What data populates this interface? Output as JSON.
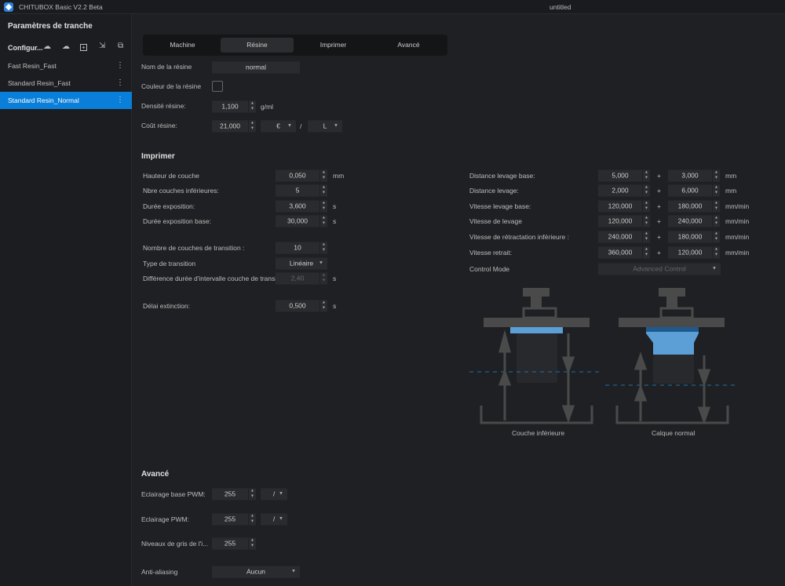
{
  "app": {
    "title": "CHITUBOX Basic V2.2 Beta",
    "document": "untitled"
  },
  "sidebar": {
    "title": "Paramètres de tranche",
    "config_label": "Configur...",
    "items": [
      {
        "label": "Fast Resin_Fast"
      },
      {
        "label": "Standard Resin_Fast"
      },
      {
        "label": "Standard Resin_Normal",
        "selected": true
      }
    ]
  },
  "tabs": [
    "Machine",
    "Résine",
    "Imprimer",
    "Avancé"
  ],
  "active_tab": "Résine",
  "resin": {
    "name_label": "Nom de la résine",
    "name_value": "normal",
    "color_label": "Couleur de la résine",
    "density_label": "Densité résine:",
    "density_value": "1,100",
    "density_unit": "g/ml",
    "cost_label": "Coût résine:",
    "cost_value": "21,000",
    "currency": "€",
    "slash": "/",
    "volume_unit": "L"
  },
  "print": {
    "title": "Imprimer",
    "left": [
      {
        "label": "Hauteur de couche",
        "value": "0,050",
        "unit": "mm"
      },
      {
        "label": "Nbre couches inférieures:",
        "value": "5",
        "unit": ""
      },
      {
        "label": "Durée exposition:",
        "value": "3,600",
        "unit": "s"
      },
      {
        "label": "Durée exposition base:",
        "value": "30,000",
        "unit": "s"
      },
      {
        "label": "Nombre de couches de transition :",
        "value": "10",
        "unit": ""
      },
      {
        "label": "Type de transition",
        "value": "Linéaire",
        "unit": "",
        "type": "select"
      },
      {
        "label": "Différence durée d'intervalle couche de transit...",
        "value": "2,40",
        "unit": "s",
        "disabled": true
      },
      {
        "label": "Délai extinction:",
        "value": "0,500",
        "unit": "s"
      }
    ],
    "right": [
      {
        "label": "Distance levage base:",
        "value1": "5,000",
        "value2": "3,000",
        "unit": "mm"
      },
      {
        "label": "Distance levage:",
        "value1": "2,000",
        "value2": "6,000",
        "unit": "mm"
      },
      {
        "label": "Vitesse levage base:",
        "value1": "120,000",
        "value2": "180,000",
        "unit": "mm/min"
      },
      {
        "label": "Vitesse de levage",
        "value1": "120,000",
        "value2": "240,000",
        "unit": "mm/min"
      },
      {
        "label": "Vitesse de rétractation inférieure :",
        "value1": "240,000",
        "value2": "180,000",
        "unit": "mm/min"
      },
      {
        "label": "Vitesse retrait:",
        "value1": "360,000",
        "value2": "120,000",
        "unit": "mm/min"
      }
    ],
    "plus": "+",
    "control_mode_label": "Control Mode",
    "control_mode_value": "Advanced Control",
    "diagram_captions": [
      "Couche inférieure",
      "Calque normal"
    ]
  },
  "advanced": {
    "title": "Avancé",
    "rows": [
      {
        "label": "Eclairage base PWM:",
        "value": "255",
        "select": "/"
      },
      {
        "label": "Eclairage PWM:",
        "value": "255",
        "select": "/"
      },
      {
        "label": "Niveaux de gris de l'i...",
        "value": "255"
      }
    ],
    "aa_label": "Anti-aliasing",
    "aa_value": "Aucun"
  },
  "colors": {
    "accent": "#0a7fd9",
    "layer_blue": "#5b9fd6",
    "dashed": "#1e6fb0"
  }
}
